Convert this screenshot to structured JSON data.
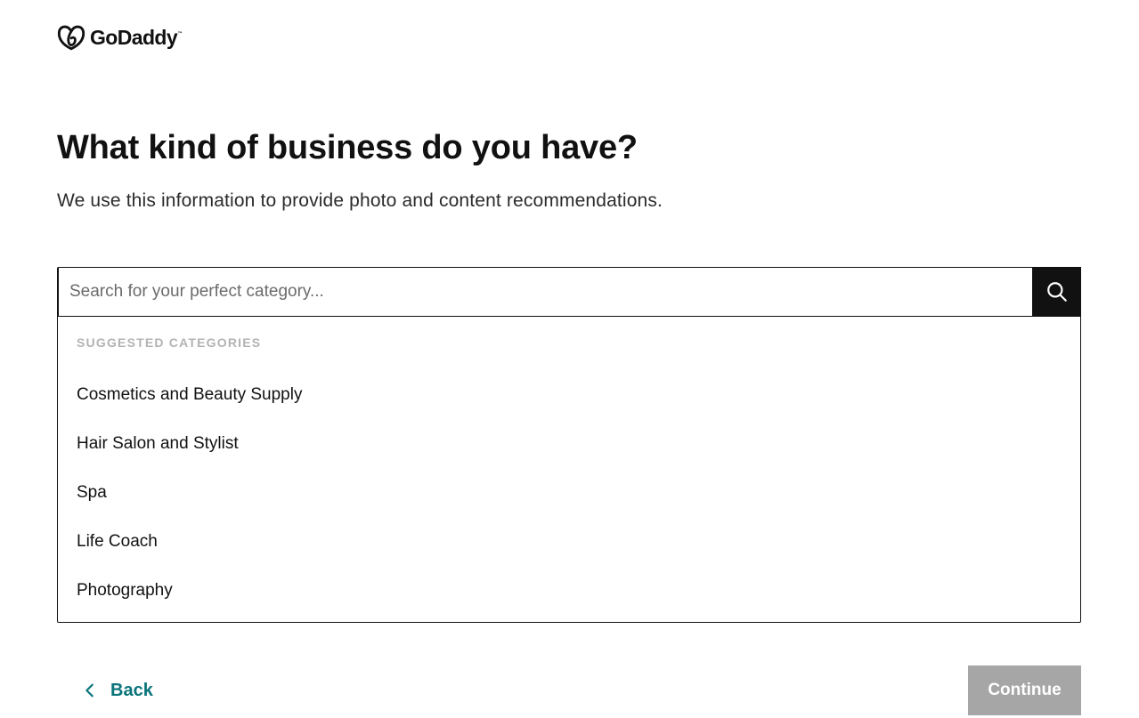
{
  "logo": {
    "text": "GoDaddy",
    "tm": "™"
  },
  "heading": {
    "title": "What kind of business do you have?",
    "subtitle": "We use this information to provide photo and content recommendations."
  },
  "search": {
    "value": "",
    "placeholder": "Search for your perfect category...",
    "button_icon": "search-icon"
  },
  "suggestions": {
    "heading": "SUGGESTED CATEGORIES",
    "items": [
      {
        "label": "Cosmetics and Beauty Supply"
      },
      {
        "label": "Hair Salon and Stylist"
      },
      {
        "label": "Spa"
      },
      {
        "label": "Life Coach"
      },
      {
        "label": "Photography"
      }
    ]
  },
  "footer": {
    "back_label": "Back",
    "back_icon": "chevron-left-icon",
    "continue_label": "Continue"
  },
  "colors": {
    "text": "#111111",
    "accent_teal": "#09757a",
    "disabled_button": "#a6a6a6",
    "muted_heading": "#b3b3b3"
  }
}
